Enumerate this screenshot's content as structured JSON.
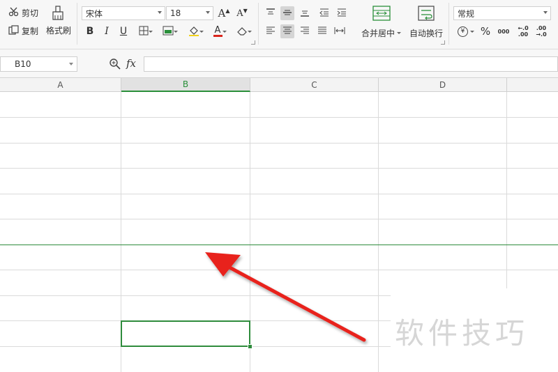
{
  "ribbon": {
    "cut_label": "剪切",
    "copy_label": "复制",
    "format_painter_label": "格式刷",
    "font_name": "宋体",
    "font_size": "18",
    "merge_center_label": "合并居中",
    "wrap_text_label": "自动换行",
    "number_format": "常规",
    "increase_font_glyph": "A",
    "decrease_font_glyph": "A",
    "bold_glyph": "B",
    "italic_glyph": "I",
    "underline_glyph": "U",
    "font_color_glyph": "A",
    "percent_glyph": "%",
    "thousands_glyph": "000",
    "dec_increase_glyph": ".00",
    "dec_decrease_glyph": ".00",
    "currency_glyph": "¥"
  },
  "formula_bar": {
    "name_box": "B10",
    "fx_label": "fx",
    "formula_value": ""
  },
  "sheet": {
    "columns": [
      "A",
      "B",
      "C",
      "D"
    ],
    "selected_column": "B",
    "selected_cell": "B10"
  },
  "watermark": "软件技巧",
  "colors": {
    "selection": "#2e8b3c",
    "arrow": "#e8221b",
    "font_color_bar": "#d9251c"
  }
}
